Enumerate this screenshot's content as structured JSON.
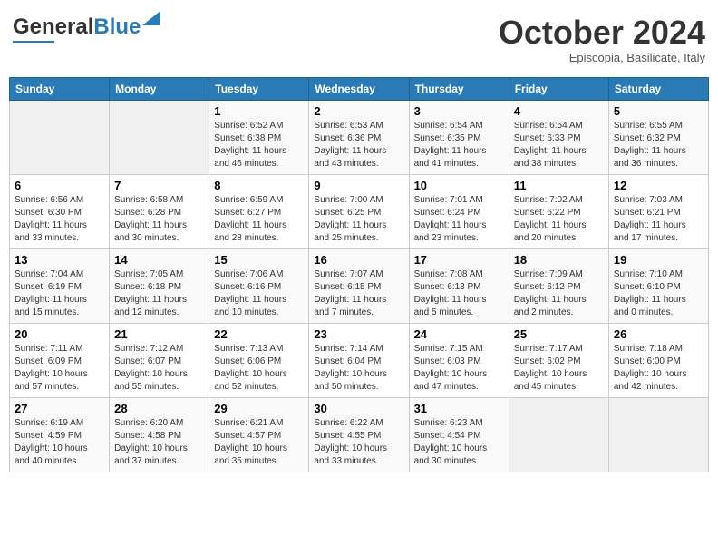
{
  "header": {
    "logo_general": "General",
    "logo_blue": "Blue",
    "month": "October 2024",
    "location": "Episcopia, Basilicate, Italy"
  },
  "weekdays": [
    "Sunday",
    "Monday",
    "Tuesday",
    "Wednesday",
    "Thursday",
    "Friday",
    "Saturday"
  ],
  "weeks": [
    [
      {
        "day": "",
        "empty": true
      },
      {
        "day": "",
        "empty": true
      },
      {
        "day": "1",
        "sunrise": "6:52 AM",
        "sunset": "6:38 PM",
        "daylight": "11 hours and 46 minutes."
      },
      {
        "day": "2",
        "sunrise": "6:53 AM",
        "sunset": "6:36 PM",
        "daylight": "11 hours and 43 minutes."
      },
      {
        "day": "3",
        "sunrise": "6:54 AM",
        "sunset": "6:35 PM",
        "daylight": "11 hours and 41 minutes."
      },
      {
        "day": "4",
        "sunrise": "6:54 AM",
        "sunset": "6:33 PM",
        "daylight": "11 hours and 38 minutes."
      },
      {
        "day": "5",
        "sunrise": "6:55 AM",
        "sunset": "6:32 PM",
        "daylight": "11 hours and 36 minutes."
      }
    ],
    [
      {
        "day": "6",
        "sunrise": "6:56 AM",
        "sunset": "6:30 PM",
        "daylight": "11 hours and 33 minutes."
      },
      {
        "day": "7",
        "sunrise": "6:58 AM",
        "sunset": "6:28 PM",
        "daylight": "11 hours and 30 minutes."
      },
      {
        "day": "8",
        "sunrise": "6:59 AM",
        "sunset": "6:27 PM",
        "daylight": "11 hours and 28 minutes."
      },
      {
        "day": "9",
        "sunrise": "7:00 AM",
        "sunset": "6:25 PM",
        "daylight": "11 hours and 25 minutes."
      },
      {
        "day": "10",
        "sunrise": "7:01 AM",
        "sunset": "6:24 PM",
        "daylight": "11 hours and 23 minutes."
      },
      {
        "day": "11",
        "sunrise": "7:02 AM",
        "sunset": "6:22 PM",
        "daylight": "11 hours and 20 minutes."
      },
      {
        "day": "12",
        "sunrise": "7:03 AM",
        "sunset": "6:21 PM",
        "daylight": "11 hours and 17 minutes."
      }
    ],
    [
      {
        "day": "13",
        "sunrise": "7:04 AM",
        "sunset": "6:19 PM",
        "daylight": "11 hours and 15 minutes."
      },
      {
        "day": "14",
        "sunrise": "7:05 AM",
        "sunset": "6:18 PM",
        "daylight": "11 hours and 12 minutes."
      },
      {
        "day": "15",
        "sunrise": "7:06 AM",
        "sunset": "6:16 PM",
        "daylight": "11 hours and 10 minutes."
      },
      {
        "day": "16",
        "sunrise": "7:07 AM",
        "sunset": "6:15 PM",
        "daylight": "11 hours and 7 minutes."
      },
      {
        "day": "17",
        "sunrise": "7:08 AM",
        "sunset": "6:13 PM",
        "daylight": "11 hours and 5 minutes."
      },
      {
        "day": "18",
        "sunrise": "7:09 AM",
        "sunset": "6:12 PM",
        "daylight": "11 hours and 2 minutes."
      },
      {
        "day": "19",
        "sunrise": "7:10 AM",
        "sunset": "6:10 PM",
        "daylight": "11 hours and 0 minutes."
      }
    ],
    [
      {
        "day": "20",
        "sunrise": "7:11 AM",
        "sunset": "6:09 PM",
        "daylight": "10 hours and 57 minutes."
      },
      {
        "day": "21",
        "sunrise": "7:12 AM",
        "sunset": "6:07 PM",
        "daylight": "10 hours and 55 minutes."
      },
      {
        "day": "22",
        "sunrise": "7:13 AM",
        "sunset": "6:06 PM",
        "daylight": "10 hours and 52 minutes."
      },
      {
        "day": "23",
        "sunrise": "7:14 AM",
        "sunset": "6:04 PM",
        "daylight": "10 hours and 50 minutes."
      },
      {
        "day": "24",
        "sunrise": "7:15 AM",
        "sunset": "6:03 PM",
        "daylight": "10 hours and 47 minutes."
      },
      {
        "day": "25",
        "sunrise": "7:17 AM",
        "sunset": "6:02 PM",
        "daylight": "10 hours and 45 minutes."
      },
      {
        "day": "26",
        "sunrise": "7:18 AM",
        "sunset": "6:00 PM",
        "daylight": "10 hours and 42 minutes."
      }
    ],
    [
      {
        "day": "27",
        "sunrise": "6:19 AM",
        "sunset": "4:59 PM",
        "daylight": "10 hours and 40 minutes."
      },
      {
        "day": "28",
        "sunrise": "6:20 AM",
        "sunset": "4:58 PM",
        "daylight": "10 hours and 37 minutes."
      },
      {
        "day": "29",
        "sunrise": "6:21 AM",
        "sunset": "4:57 PM",
        "daylight": "10 hours and 35 minutes."
      },
      {
        "day": "30",
        "sunrise": "6:22 AM",
        "sunset": "4:55 PM",
        "daylight": "10 hours and 33 minutes."
      },
      {
        "day": "31",
        "sunrise": "6:23 AM",
        "sunset": "4:54 PM",
        "daylight": "10 hours and 30 minutes."
      },
      {
        "day": "",
        "empty": true
      },
      {
        "day": "",
        "empty": true
      }
    ]
  ],
  "labels": {
    "sunrise": "Sunrise:",
    "sunset": "Sunset:",
    "daylight": "Daylight:"
  }
}
